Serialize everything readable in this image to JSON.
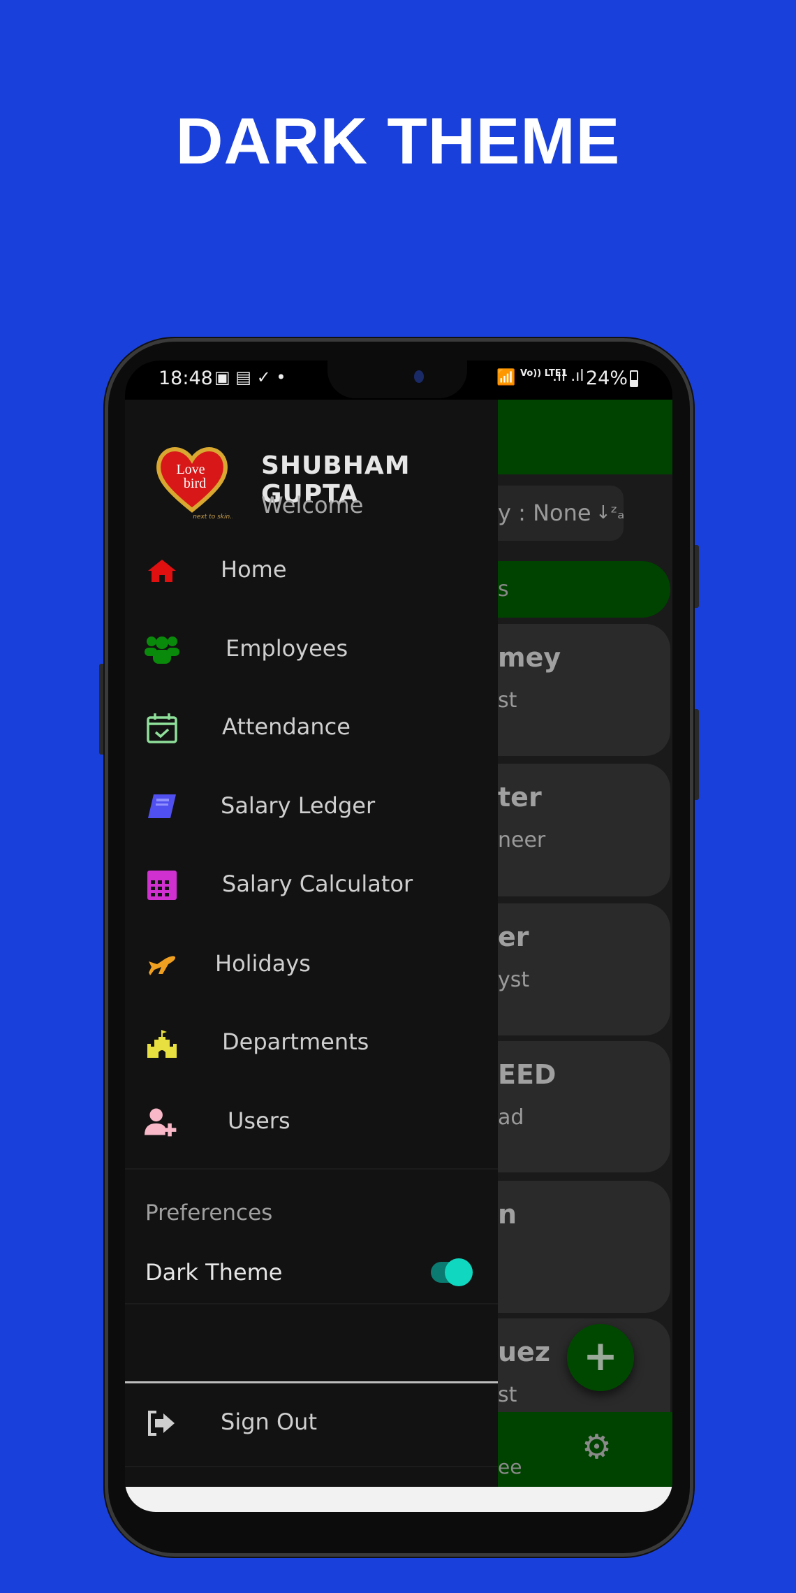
{
  "banner_title": "DARK THEME",
  "status_bar": {
    "time": "18:48",
    "battery": "24%",
    "network": "Vo)) LTE1"
  },
  "drawer": {
    "user_name": "SHUBHAM GUPTA",
    "greeting": "Welcome",
    "logo_text": "Love bird",
    "menu": [
      {
        "label": "Home",
        "icon": "home-icon",
        "color": "#e01010"
      },
      {
        "label": "Employees",
        "icon": "users-group-icon",
        "color": "#0a8a0a"
      },
      {
        "label": "Attendance",
        "icon": "calendar-check-icon",
        "color": "#8fe09a"
      },
      {
        "label": "Salary Ledger",
        "icon": "book-icon",
        "color": "#5050f0"
      },
      {
        "label": "Salary Calculator",
        "icon": "calculator-icon",
        "color": "#d030d0"
      },
      {
        "label": "Holidays",
        "icon": "plane-icon",
        "color": "#f0a020"
      },
      {
        "label": "Departments",
        "icon": "castle-icon",
        "color": "#e8e040"
      },
      {
        "label": "Users",
        "icon": "user-plus-icon",
        "color": "#f8b8c8"
      }
    ],
    "preferences_label": "Preferences",
    "dark_theme_label": "Dark Theme",
    "dark_theme_on": true,
    "sign_out_label": "Sign Out"
  },
  "background_app": {
    "sort_text": "y : None",
    "pill_text": "s",
    "cards": [
      {
        "name": "mey",
        "role": "st"
      },
      {
        "name": "ter",
        "role": "neer"
      },
      {
        "name": "er",
        "role": "yst"
      },
      {
        "name": "EED",
        "role": "ad"
      },
      {
        "name": "n",
        "role": ""
      },
      {
        "name": "uez",
        "role": "st"
      }
    ],
    "fab_label": "+",
    "bottom_nav_text": "ee"
  },
  "colors": {
    "background": "#1a40dc",
    "app_green": "#004200",
    "toggle": "#10d8c0"
  }
}
